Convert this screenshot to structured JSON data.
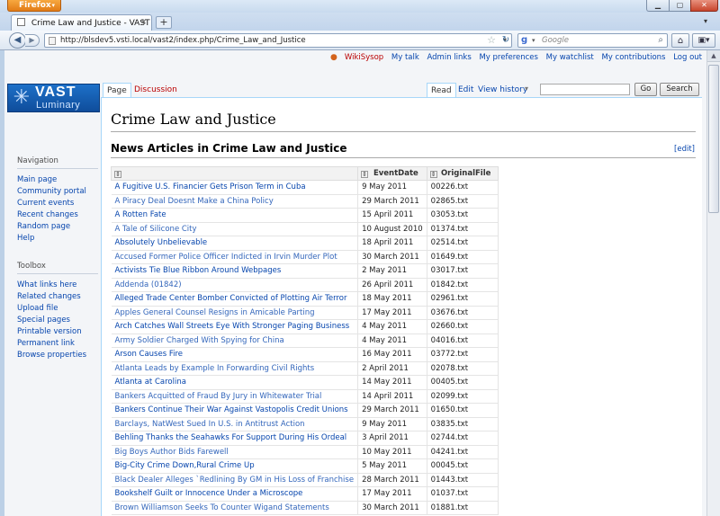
{
  "browser": {
    "menu_label": "Firefox",
    "tab_title": "Crime Law and Justice - VAST",
    "url": "http://blsdev5.vsti.local/vast2/index.php/Crime_Law_and_Justice",
    "search_engine": "Google",
    "search_placeholder": "Google"
  },
  "personal": {
    "username": "WikiSysop",
    "links": [
      "My talk",
      "Admin links",
      "My preferences",
      "My watchlist",
      "My contributions",
      "Log out"
    ]
  },
  "logo": {
    "line1": "VAST",
    "line2": "Luminary"
  },
  "tabs": {
    "page": "Page",
    "discussion": "Discussion",
    "read": "Read",
    "edit": "Edit",
    "history": "View history"
  },
  "search": {
    "go": "Go",
    "search": "Search"
  },
  "page": {
    "title": "Crime Law and Justice",
    "section": "News Articles in Crime Law and Justice",
    "edit_link": "[edit]"
  },
  "table": {
    "headers": [
      "",
      "EventDate",
      "OriginalFile"
    ],
    "rows": [
      [
        "A Fugitive U.S. Financier Gets Prison Term in Cuba",
        "9 May 2011",
        "00226.txt"
      ],
      [
        "A Piracy Deal Doesnt Make a China Policy",
        "29 March 2011",
        "02865.txt"
      ],
      [
        "A Rotten Fate",
        "15 April 2011",
        "03053.txt"
      ],
      [
        "A Tale of Silicone City",
        "10 August 2010",
        "01374.txt"
      ],
      [
        "Absolutely Unbelievable",
        "18 April 2011",
        "02514.txt"
      ],
      [
        "Accused Former Police Officer Indicted in Irvin Murder Plot",
        "30 March 2011",
        "01649.txt"
      ],
      [
        "Activists Tie Blue Ribbon Around Webpages",
        "2 May 2011",
        "03017.txt"
      ],
      [
        "Addenda (01842)",
        "26 April 2011",
        "01842.txt"
      ],
      [
        "Alleged Trade Center Bomber Convicted of Plotting Air Terror",
        "18 May 2011",
        "02961.txt"
      ],
      [
        "Apples General Counsel Resigns in Amicable Parting",
        "17 May 2011",
        "03676.txt"
      ],
      [
        "Arch Catches Wall Streets Eye With Stronger Paging Business",
        "4 May 2011",
        "02660.txt"
      ],
      [
        "Army Soldier Charged With Spying for China",
        "4 May 2011",
        "04016.txt"
      ],
      [
        "Arson Causes Fire",
        "16 May 2011",
        "03772.txt"
      ],
      [
        "Atlanta Leads by Example In Forwarding Civil Rights",
        "2 April 2011",
        "02078.txt"
      ],
      [
        "Atlanta at Carolina",
        "14 May 2011",
        "00405.txt"
      ],
      [
        "Bankers Acquitted of Fraud By Jury in Whitewater Trial",
        "14 April 2011",
        "02099.txt"
      ],
      [
        "Bankers Continue Their War Against Vastopolis Credit Unions",
        "29 March 2011",
        "01650.txt"
      ],
      [
        "Barclays, NatWest Sued In U.S. in Antitrust Action",
        "9 May 2011",
        "03835.txt"
      ],
      [
        "Behling Thanks the Seahawks For Support During His Ordeal",
        "3 April 2011",
        "02744.txt"
      ],
      [
        "Big Boys Author Bids Farewell",
        "10 May 2011",
        "04241.txt"
      ],
      [
        "Big-City Crime Down,Rural Crime Up",
        "5 May 2011",
        "00045.txt"
      ],
      [
        "Black Dealer Alleges `Redlining By GM in His Loss of Franchise",
        "28 March 2011",
        "01443.txt"
      ],
      [
        "Bookshelf Guilt or Innocence Under a Microscope",
        "17 May 2011",
        "01037.txt"
      ],
      [
        "Brown Williamson Seeks To Counter Wigand Statements",
        "30 March 2011",
        "01881.txt"
      ]
    ]
  },
  "sidebar": {
    "navigation_title": "Navigation",
    "navigation": [
      "Main page",
      "Community portal",
      "Current events",
      "Recent changes",
      "Random page",
      "Help"
    ],
    "toolbox_title": "Toolbox",
    "toolbox": [
      "What links here",
      "Related changes",
      "Upload file",
      "Special pages",
      "Printable version",
      "Permanent link",
      "Browse properties"
    ]
  }
}
